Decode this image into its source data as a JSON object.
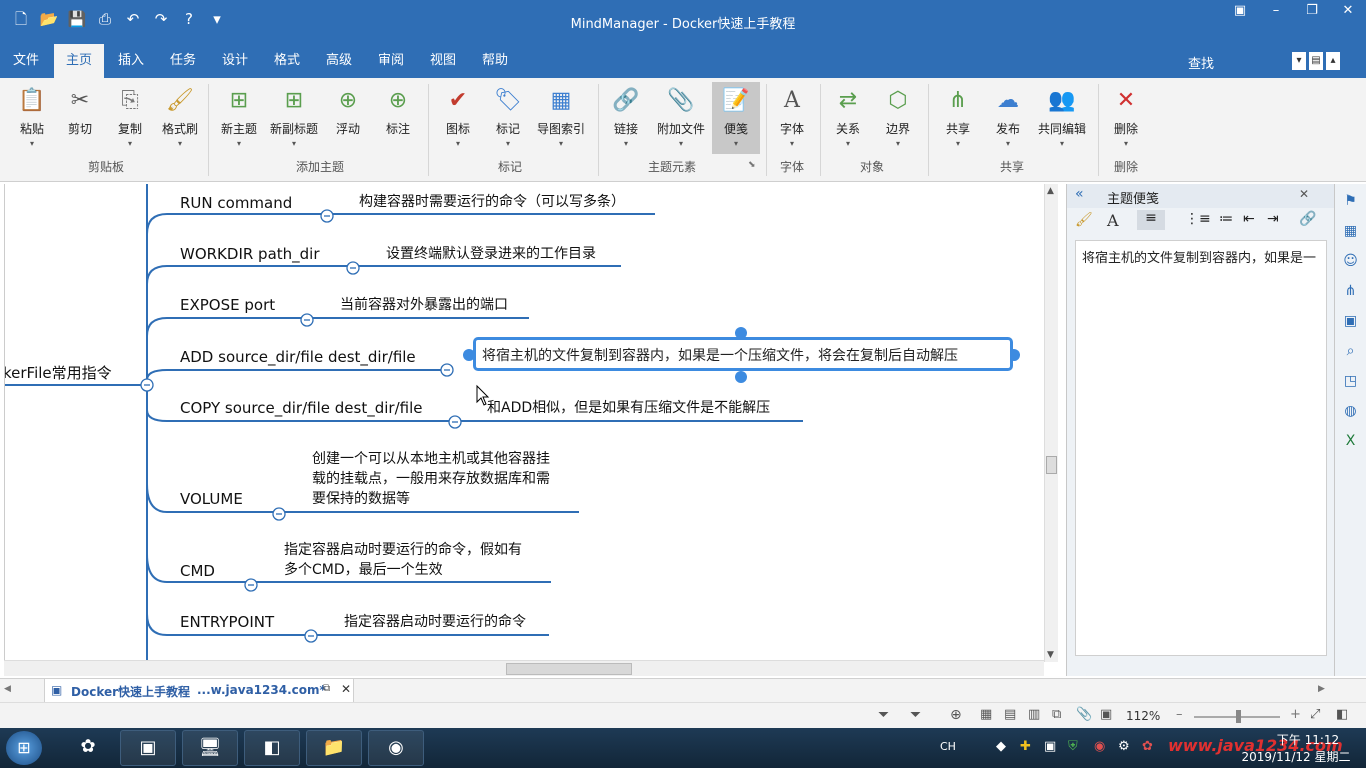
{
  "window": {
    "title": "MindManager - Docker快速上手教程"
  },
  "menu": {
    "tabs": [
      "文件",
      "主页",
      "插入",
      "任务",
      "设计",
      "格式",
      "高级",
      "审阅",
      "视图",
      "帮助"
    ],
    "active": "主页",
    "find_label": "查找"
  },
  "ribbon": {
    "groups": [
      {
        "label": "剪贴板",
        "buttons": [
          "粘贴",
          "剪切",
          "复制",
          "格式刷"
        ]
      },
      {
        "label": "添加主题",
        "buttons": [
          "新主题",
          "新副标题",
          "浮动",
          "标注"
        ]
      },
      {
        "label": "标记",
        "buttons": [
          "图标",
          "标记",
          "导图索引"
        ]
      },
      {
        "label": "主题元素",
        "buttons": [
          "链接",
          "附加文件",
          "便笺"
        ]
      },
      {
        "label": "字体",
        "buttons": [
          "字体"
        ]
      },
      {
        "label": "对象",
        "buttons": [
          "关系",
          "边界"
        ]
      },
      {
        "label": "共享",
        "buttons": [
          "共享",
          "发布",
          "共同编辑"
        ]
      },
      {
        "label": "删除",
        "buttons": [
          "删除"
        ]
      }
    ]
  },
  "mindmap": {
    "root_label": "kerFile常用指令",
    "topics": [
      {
        "label": "RUN command",
        "note": "构建容器时需要运行的命令（可以写多条）"
      },
      {
        "label": "WORKDIR path_dir",
        "note": "设置终端默认登录进来的工作目录"
      },
      {
        "label": "EXPOSE port",
        "note": "当前容器对外暴露出的端口"
      },
      {
        "label": "ADD source_dir/file dest_dir/file",
        "note": "将宿主机的文件复制到容器内，如果是一个压缩文件，将会在复制后自动解压"
      },
      {
        "label": "COPY source_dir/file dest_dir/file",
        "note": "和ADD相似，但是如果有压缩文件是不能解压"
      },
      {
        "label": "VOLUME",
        "note_lines": [
          "创建一个可以从本地主机或其他容器挂",
          "载的挂载点，一般用来存放数据库和需",
          "要保持的数据等"
        ]
      },
      {
        "label": "CMD",
        "note_lines": [
          "指定容器启动时要运行的命令，假如有",
          "多个CMD，最后一个生效"
        ]
      },
      {
        "label": "ENTRYPOINT",
        "note": "指定容器启动时要运行的命令"
      }
    ]
  },
  "notes_pane": {
    "title": "主题便笺",
    "body": "将宿主机的文件复制到容器内，如果是一"
  },
  "doc_tab": {
    "name": "Docker快速上手教程",
    "path": "...w.java1234.com*"
  },
  "status": {
    "zoom": "112%"
  },
  "taskbar": {
    "ime": "CH",
    "time": "下午 11:12",
    "date": "2019/11/12 星期二",
    "watermark": "www.java1234.com"
  }
}
